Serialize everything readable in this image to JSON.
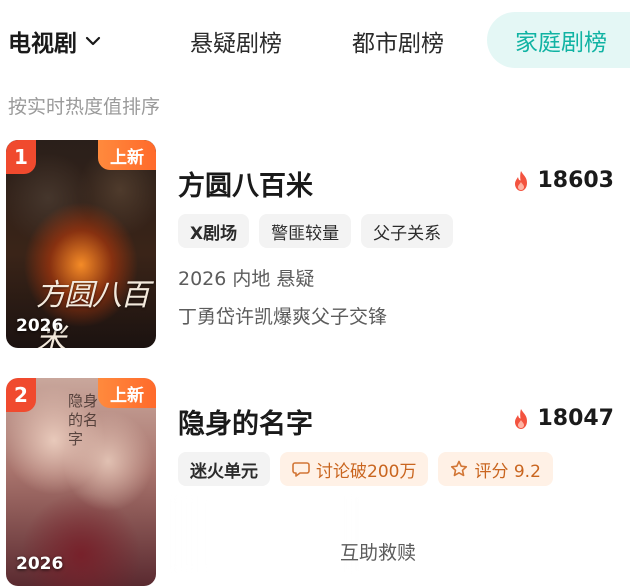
{
  "tabbar": {
    "category": "电视剧",
    "tabs": [
      "悬疑剧榜",
      "都市剧榜"
    ],
    "active_tab": "家庭剧榜"
  },
  "sort_hint": "按实时热度值排序",
  "items": [
    {
      "rank": "1",
      "new_label": "上新",
      "poster_year": "2026",
      "poster_title_art": "方圆八百米",
      "title": "方圆八百米",
      "heat": "18603",
      "tags": [
        "X剧场",
        "警匪较量",
        "父子关系"
      ],
      "meta": "2026 内地 悬疑",
      "desc": "丁勇岱许凯爆爽父子交锋"
    },
    {
      "rank": "2",
      "new_label": "上新",
      "poster_year": "2026",
      "poster_title_art": "隐身的名字",
      "title": "隐身的名字",
      "heat": "18047",
      "tags": [
        "迷火单元",
        "讨论破200万",
        "评分 9.2"
      ],
      "desc": "互助救赎"
    }
  ],
  "colors": {
    "accent_teal": "#10b3a3",
    "rank_red": "#f04a2e",
    "new_orange": "#ff7a33",
    "flame": "#f3533f"
  },
  "icons": [
    "chevron-down-icon",
    "flame-icon",
    "speech-bubble-icon",
    "star-badge-icon"
  ]
}
